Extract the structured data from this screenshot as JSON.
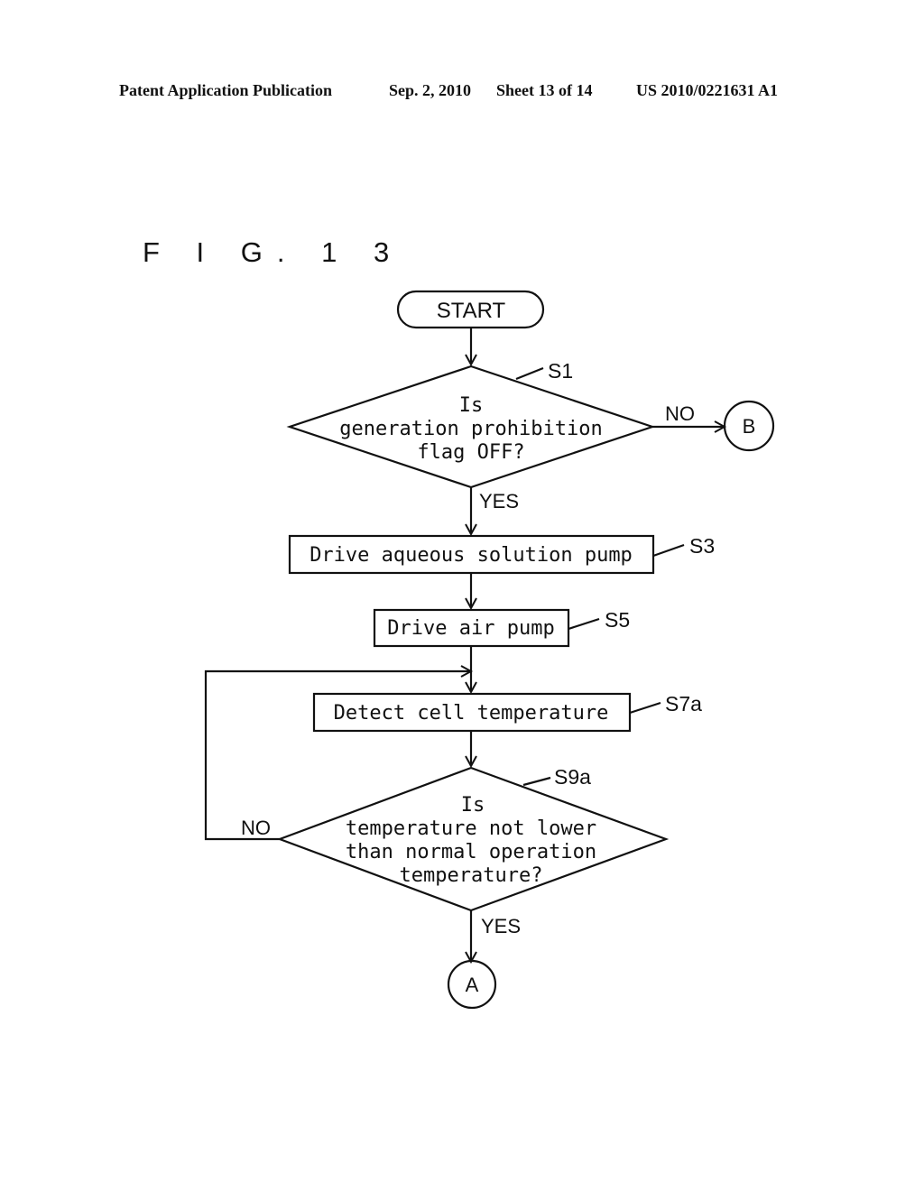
{
  "header": {
    "publication": "Patent Application Publication",
    "date": "Sep. 2, 2010",
    "sheet": "Sheet 13 of 14",
    "number": "US 2010/0221631 A1"
  },
  "figure": {
    "title": "F I G. 1 3"
  },
  "flowchart": {
    "start": "START",
    "s1": {
      "id": "S1",
      "lines": [
        "Is",
        "generation prohibition",
        "flag OFF?"
      ],
      "no": "NO",
      "yes": "YES"
    },
    "connector_b": "B",
    "s3": {
      "id": "S3",
      "text": "Drive aqueous solution pump"
    },
    "s5": {
      "id": "S5",
      "text": "Drive air pump"
    },
    "s7a": {
      "id": "S7a",
      "text": "Detect cell temperature"
    },
    "s9a": {
      "id": "S9a",
      "lines": [
        "Is",
        "temperature not lower",
        "than normal operation",
        "temperature?"
      ],
      "no": "NO",
      "yes": "YES"
    },
    "connector_a": "A"
  }
}
